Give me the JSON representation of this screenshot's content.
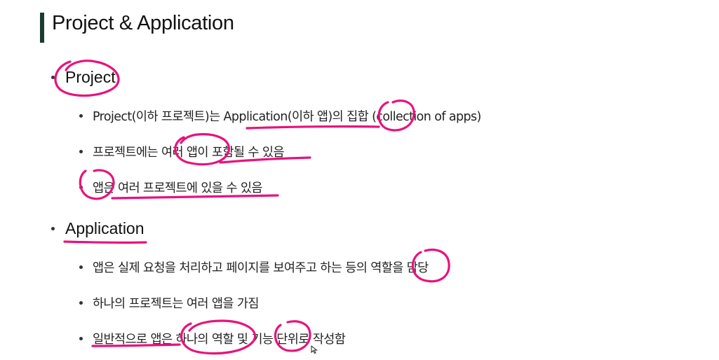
{
  "slide": {
    "title": "Project & Application"
  },
  "sections": [
    {
      "heading": "Project",
      "items": [
        "Project(이하 프로젝트)는 Application(이하 앱)의 집합 (collection of apps)",
        "프로젝트에는 여러 앱이 포함될 수 있음",
        "앱은 여러 프로젝트에 있을 수 있음"
      ]
    },
    {
      "heading": "Application",
      "items": [
        "앱은 실제 요청을 처리하고 페이지를 보여주고 하는 등의 역할을 담당",
        "하나의 프로젝트는 여러 앱을 가짐",
        "일반적으로 앱은 하나의 역할 및 기능 단위로 작성함"
      ]
    }
  ],
  "annotation": {
    "color": "#e8127c"
  }
}
